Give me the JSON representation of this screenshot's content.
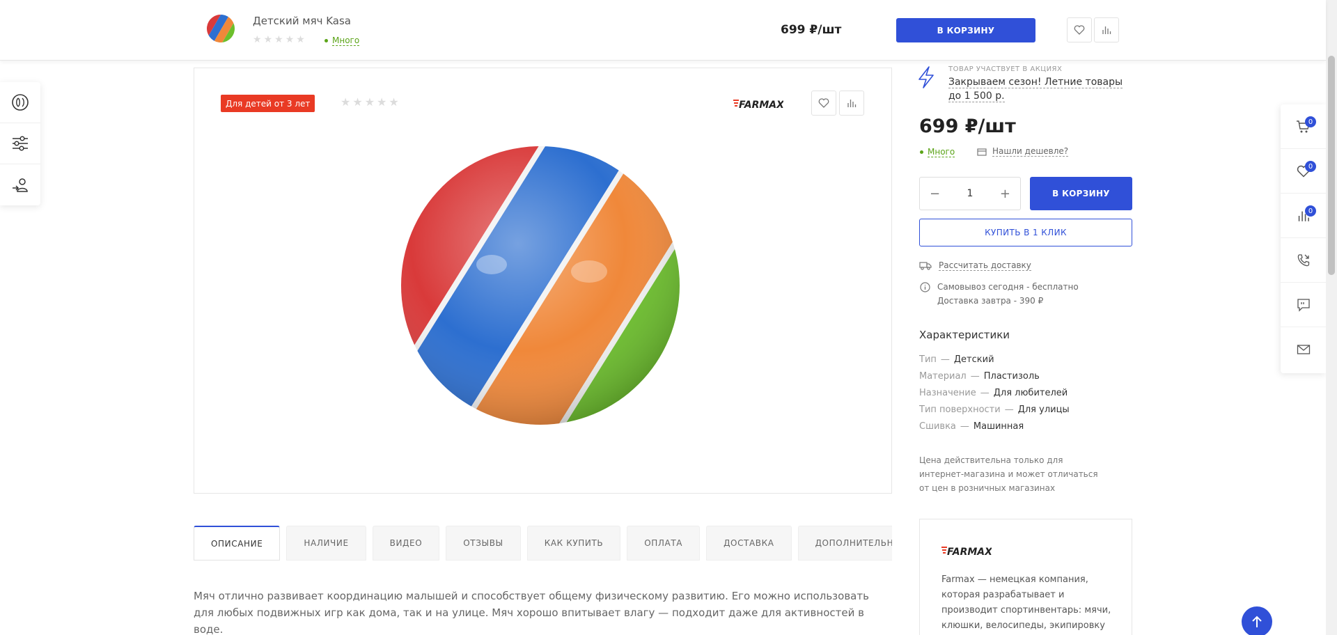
{
  "sticky": {
    "title": "Детский мяч Kasa",
    "stars": [
      "★",
      "★",
      "★",
      "★",
      "★"
    ],
    "stock": "Много",
    "price": "699 ₽/шт",
    "cart_label": "В КОРЗИНУ"
  },
  "gallery": {
    "age_badge": "Для детей от 3 лет",
    "stars": [
      "★",
      "★",
      "★",
      "★",
      "★"
    ],
    "brand": "FARMAX"
  },
  "info": {
    "promo_label": "ТОВАР УЧАСТВУЕТ В АКЦИЯХ",
    "promo_link": "Закрываем сезон! Летние товары до 1 500 р.",
    "price": "699 ₽/шт",
    "stock": "Много",
    "cheaper": "Нашли дешевле?",
    "qty_value": "1",
    "qty_minus": "−",
    "qty_plus": "+",
    "cart_label": "В КОРЗИНУ",
    "oneclick_label": "КУПИТЬ В 1 КЛИК",
    "delivery_calc": "Рассчитать доставку",
    "pickup_line1": "Самовывоз сегодня - бесплатно",
    "pickup_line2": "Доставка завтра - 390 ₽"
  },
  "characteristics": {
    "title": "Характеристики",
    "separator": "—",
    "rows": [
      {
        "key": "Тип",
        "value": "Детский"
      },
      {
        "key": "Материал",
        "value": "Пластизоль"
      },
      {
        "key": "Назначение",
        "value": "Для любителей"
      },
      {
        "key": "Тип поверхности",
        "value": "Для улицы"
      },
      {
        "key": "Сшивка",
        "value": "Машинная"
      }
    ],
    "price_note": "Цена действительна только для интернет-магазина и может отличаться от цен в розничных магазинах"
  },
  "brand_card": {
    "logo": "FARMAX",
    "text": "Farmax — немецкая компания, которая разрабатывает и производит спортинвентарь: мячи, клюшки, велосипеды, экипировку"
  },
  "tabs": [
    {
      "label": "ОПИСАНИЕ",
      "active": true
    },
    {
      "label": "НАЛИЧИЕ",
      "active": false
    },
    {
      "label": "ВИДЕО",
      "active": false
    },
    {
      "label": "ОТЗЫВЫ",
      "active": false
    },
    {
      "label": "КАК КУПИТЬ",
      "active": false
    },
    {
      "label": "ОПЛАТА",
      "active": false
    },
    {
      "label": "ДОСТАВКА",
      "active": false
    },
    {
      "label": "ДОПОЛНИТЕЛЬНО",
      "active": false
    }
  ],
  "description": "Мяч отлично развивает координацию малышей и способствует общему физическому развитию. Его можно использовать для любых подвижных игр как дома, так и на улице. Мяч хорошо впитывает влагу — подходит даже для активностей в воде.",
  "right_panel": {
    "cart_count": "0",
    "favorites_count": "0",
    "compare_count": "0"
  },
  "colors": {
    "accent": "#3050d8",
    "stock_green": "#5ba418",
    "badge_red": "#e93a24",
    "ball_red": "#d93a3a",
    "ball_blue": "#2d6fd0",
    "ball_orange": "#f0883a",
    "ball_green": "#6cbf2c"
  },
  "icons": {
    "left_panel": [
      "catalog-icon",
      "filters-icon",
      "user-login-icon"
    ],
    "right_panel": [
      "cart-icon",
      "heart-icon",
      "compare-icon",
      "callback-icon",
      "chat-icon",
      "mail-icon"
    ],
    "scroll_up": "arrow-up-icon"
  }
}
